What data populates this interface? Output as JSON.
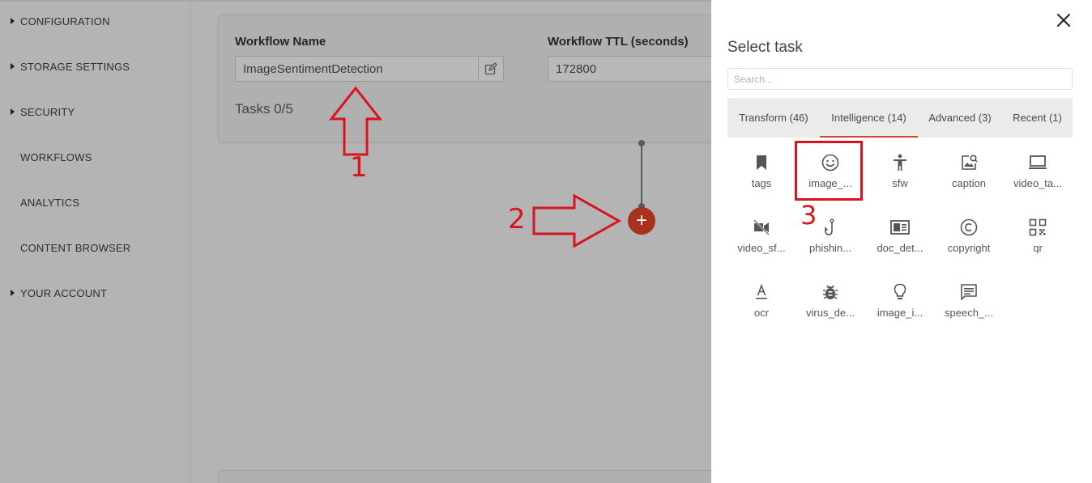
{
  "sidebar": {
    "items": [
      {
        "label": "CONFIGURATION",
        "expandable": true
      },
      {
        "label": "STORAGE SETTINGS",
        "expandable": true
      },
      {
        "label": "SECURITY",
        "expandable": true
      },
      {
        "label": "WORKFLOWS",
        "expandable": false
      },
      {
        "label": "ANALYTICS",
        "expandable": false
      },
      {
        "label": "CONTENT BROWSER",
        "expandable": false
      },
      {
        "label": "YOUR ACCOUNT",
        "expandable": true
      }
    ]
  },
  "workflow": {
    "name_label": "Workflow Name",
    "name_value": "ImageSentimentDetection",
    "ttl_label": "Workflow TTL (seconds)",
    "ttl_value": "172800",
    "tasks_count": "Tasks 0/5",
    "add_button_label": "+"
  },
  "annotations": {
    "one": "1",
    "two": "2",
    "three": "3",
    "color": "#d8151f"
  },
  "panel": {
    "title": "Select task",
    "close_icon": "close-icon",
    "search_placeholder": "Search...",
    "tabs": [
      {
        "label": "Transform (46)",
        "active": false
      },
      {
        "label": "Intelligence (14)",
        "active": true
      },
      {
        "label": "Advanced (3)",
        "active": false
      },
      {
        "label": "Recent (1)",
        "active": false
      }
    ],
    "tasks": [
      {
        "label": "tags",
        "icon": "bookmark-icon"
      },
      {
        "label": "image_...",
        "icon": "smiley-icon",
        "highlighted": true
      },
      {
        "label": "sfw",
        "icon": "accessibility-icon"
      },
      {
        "label": "caption",
        "icon": "image-search-icon"
      },
      {
        "label": "video_ta...",
        "icon": "laptop-icon"
      },
      {
        "label": "video_sf...",
        "icon": "video-off-icon"
      },
      {
        "label": "phishin...",
        "icon": "hook-icon"
      },
      {
        "label": "doc_det...",
        "icon": "document-icon"
      },
      {
        "label": "copyright",
        "icon": "copyright-icon"
      },
      {
        "label": "qr",
        "icon": "qr-code-icon"
      },
      {
        "label": "ocr",
        "icon": "text-format-icon"
      },
      {
        "label": "virus_de...",
        "icon": "bug-icon"
      },
      {
        "label": "image_i...",
        "icon": "lightbulb-icon"
      },
      {
        "label": "speech_...",
        "icon": "chat-icon"
      }
    ]
  },
  "colors": {
    "accent": "#d0482a",
    "add_button": "#a8321c",
    "overlay_gray": "#b4b4b4"
  }
}
